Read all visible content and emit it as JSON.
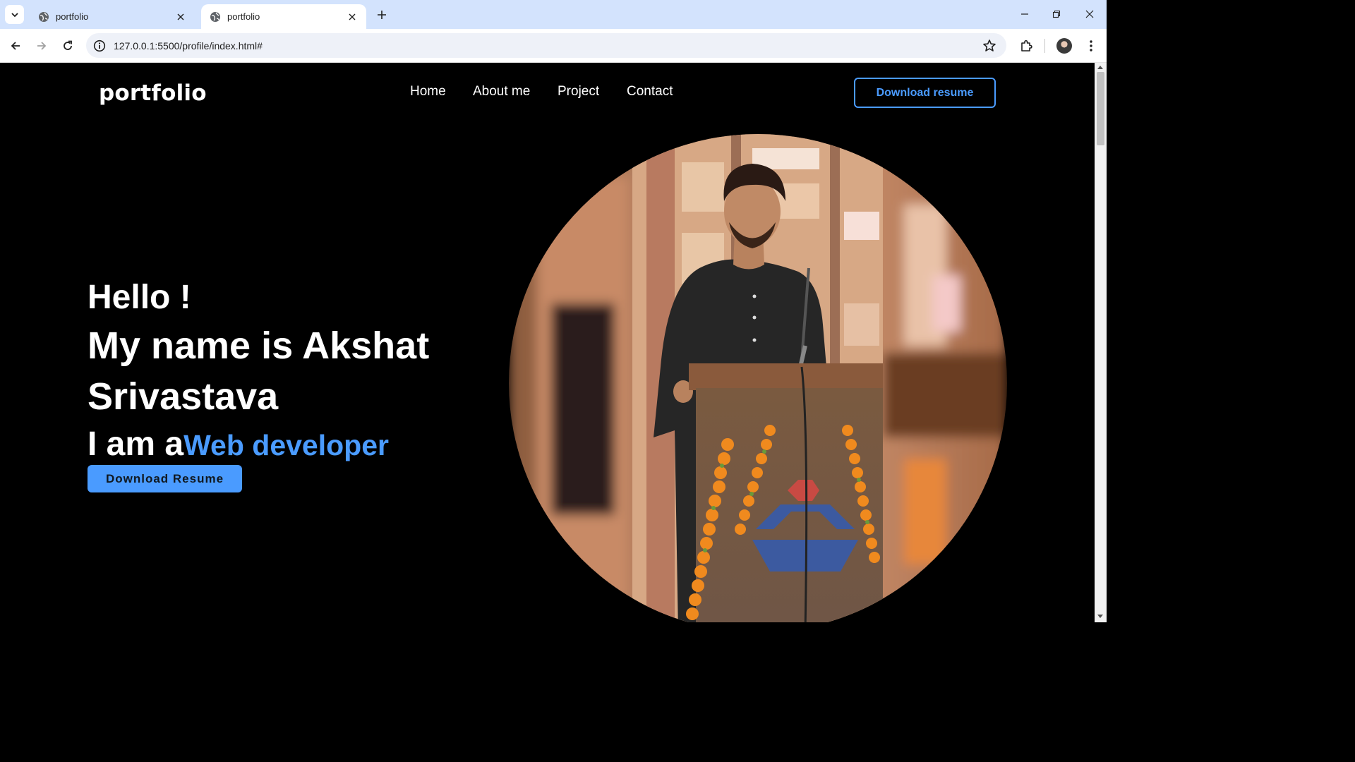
{
  "browser": {
    "tabs": [
      {
        "title": "portfolio",
        "active": false
      },
      {
        "title": "portfolio",
        "active": true
      }
    ],
    "url": "127.0.0.1:5500/profile/index.html#"
  },
  "site": {
    "logo": "portfolio",
    "nav": [
      "Home",
      "About me",
      "Project",
      "Contact"
    ],
    "download_top": "Download resume"
  },
  "hero": {
    "hello": "Hello !",
    "name_line1": "My name is Akshat",
    "name_line2": "Srivastava",
    "iam_prefix": "I am a",
    "role": "Web developer",
    "download_button": "Download Resume"
  },
  "colors": {
    "accent": "#4a9bff",
    "background": "#000000",
    "chrome_tabstrip": "#d3e3fd"
  }
}
